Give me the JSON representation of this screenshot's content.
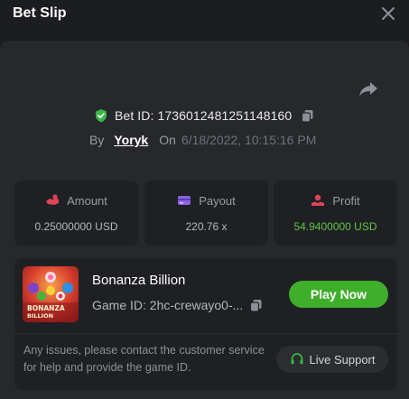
{
  "header": {
    "title": "Bet Slip"
  },
  "bet": {
    "id_label": "Bet ID: 1736012481251148160",
    "by_label": "By",
    "user": "Yoryk",
    "on_label": "On",
    "date": "6/18/2022, 10:15:16 PM"
  },
  "stats": [
    {
      "label": "Amount",
      "value": "0.25000000 USD",
      "icon": "amount-icon"
    },
    {
      "label": "Payout",
      "value": "220.76 x",
      "icon": "payout-icon"
    },
    {
      "label": "Profit",
      "value": "54.9400000 USD",
      "icon": "profit-icon"
    }
  ],
  "game": {
    "name": "Bonanza Billion",
    "id_text": "Game ID: 2hc-crewayo0-...",
    "thumb_text": "BONANZA BILLION",
    "play_label": "Play Now"
  },
  "footer": {
    "note": "Any issues, please contact the customer service for help and provide the game ID.",
    "support_label": "Live Support"
  },
  "colors": {
    "accent_green": "#3fae2a",
    "profit_green": "#60c545",
    "verified_green": "#39b54a",
    "background": "#1c1d20",
    "panel": "#27282c"
  }
}
